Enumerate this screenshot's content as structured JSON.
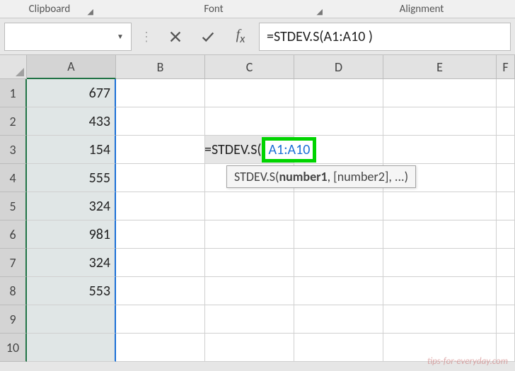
{
  "ribbon": {
    "clipboard": "Clipboard",
    "font": "Font",
    "alignment": "Alignment"
  },
  "formulaBar": {
    "nameBox": "",
    "formula": "=STDEV.S(A1:A10 )"
  },
  "columns": [
    "A",
    "B",
    "C",
    "D",
    "E",
    "F"
  ],
  "rows": [
    "1",
    "2",
    "3",
    "4",
    "5",
    "6",
    "7",
    "8",
    "9",
    "10"
  ],
  "dataA": [
    "677",
    "433",
    "154",
    "555",
    "324",
    "981",
    "324",
    "553",
    "",
    ""
  ],
  "editing": {
    "prefix": "=STDEV.S(",
    "highlight": "A1:A10"
  },
  "tooltip": {
    "fn": "STDEV.S(",
    "arg1": "number1",
    "rest": ", [number2], ...)"
  },
  "watermark": "tips-for-everyday.com"
}
